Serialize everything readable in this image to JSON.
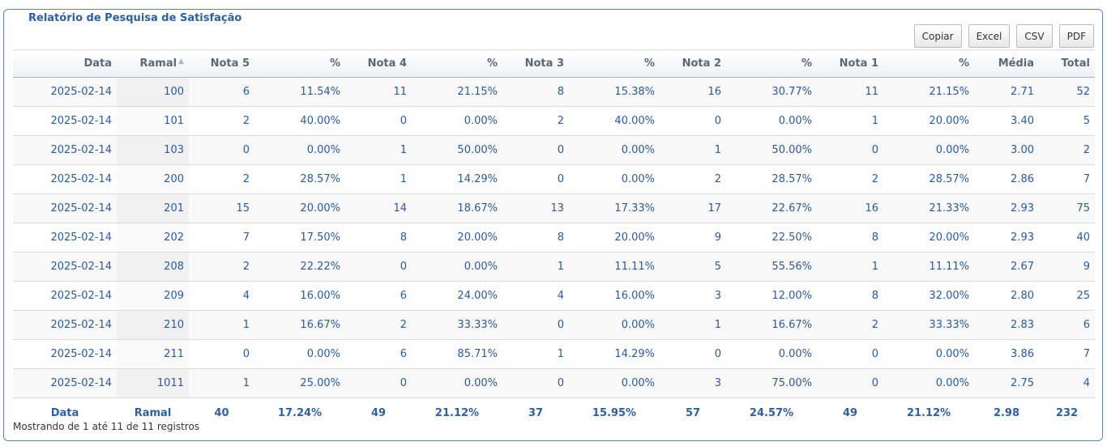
{
  "report": {
    "title": "Relatório de Pesquisa de Satisfação",
    "buttons": [
      "Copiar",
      "Excel",
      "CSV",
      "PDF"
    ],
    "columns": [
      "Data",
      "Ramal",
      "Nota 5",
      "%",
      "Nota 4",
      "%",
      "Nota 3",
      "%",
      "Nota 2",
      "%",
      "Nota 1",
      "%",
      "Média",
      "Total"
    ],
    "rows": [
      [
        "2025-02-14",
        "100",
        "6",
        "11.54%",
        "11",
        "21.15%",
        "8",
        "15.38%",
        "16",
        "30.77%",
        "11",
        "21.15%",
        "2.71",
        "52"
      ],
      [
        "2025-02-14",
        "101",
        "2",
        "40.00%",
        "0",
        "0.00%",
        "2",
        "40.00%",
        "0",
        "0.00%",
        "1",
        "20.00%",
        "3.40",
        "5"
      ],
      [
        "2025-02-14",
        "103",
        "0",
        "0.00%",
        "1",
        "50.00%",
        "0",
        "0.00%",
        "1",
        "50.00%",
        "0",
        "0.00%",
        "3.00",
        "2"
      ],
      [
        "2025-02-14",
        "200",
        "2",
        "28.57%",
        "1",
        "14.29%",
        "0",
        "0.00%",
        "2",
        "28.57%",
        "2",
        "28.57%",
        "2.86",
        "7"
      ],
      [
        "2025-02-14",
        "201",
        "15",
        "20.00%",
        "14",
        "18.67%",
        "13",
        "17.33%",
        "17",
        "22.67%",
        "16",
        "21.33%",
        "2.93",
        "75"
      ],
      [
        "2025-02-14",
        "202",
        "7",
        "17.50%",
        "8",
        "20.00%",
        "8",
        "20.00%",
        "9",
        "22.50%",
        "8",
        "20.00%",
        "2.93",
        "40"
      ],
      [
        "2025-02-14",
        "208",
        "2",
        "22.22%",
        "0",
        "0.00%",
        "1",
        "11.11%",
        "5",
        "55.56%",
        "1",
        "11.11%",
        "2.67",
        "9"
      ],
      [
        "2025-02-14",
        "209",
        "4",
        "16.00%",
        "6",
        "24.00%",
        "4",
        "16.00%",
        "3",
        "12.00%",
        "8",
        "32.00%",
        "2.80",
        "25"
      ],
      [
        "2025-02-14",
        "210",
        "1",
        "16.67%",
        "2",
        "33.33%",
        "0",
        "0.00%",
        "1",
        "16.67%",
        "2",
        "33.33%",
        "2.83",
        "6"
      ],
      [
        "2025-02-14",
        "211",
        "0",
        "0.00%",
        "6",
        "85.71%",
        "1",
        "14.29%",
        "0",
        "0.00%",
        "0",
        "0.00%",
        "3.86",
        "7"
      ],
      [
        "2025-02-14",
        "1011",
        "1",
        "25.00%",
        "0",
        "0.00%",
        "0",
        "0.00%",
        "3",
        "75.00%",
        "0",
        "0.00%",
        "2.75",
        "4"
      ]
    ],
    "footer": [
      "Data",
      "Ramal",
      "40",
      "17.24%",
      "49",
      "21.12%",
      "37",
      "15.95%",
      "57",
      "24.57%",
      "49",
      "21.12%",
      "2.98",
      "232"
    ],
    "info": "Mostrando de 1 até 11 de 11 registros",
    "sort_indicator": "▲"
  }
}
